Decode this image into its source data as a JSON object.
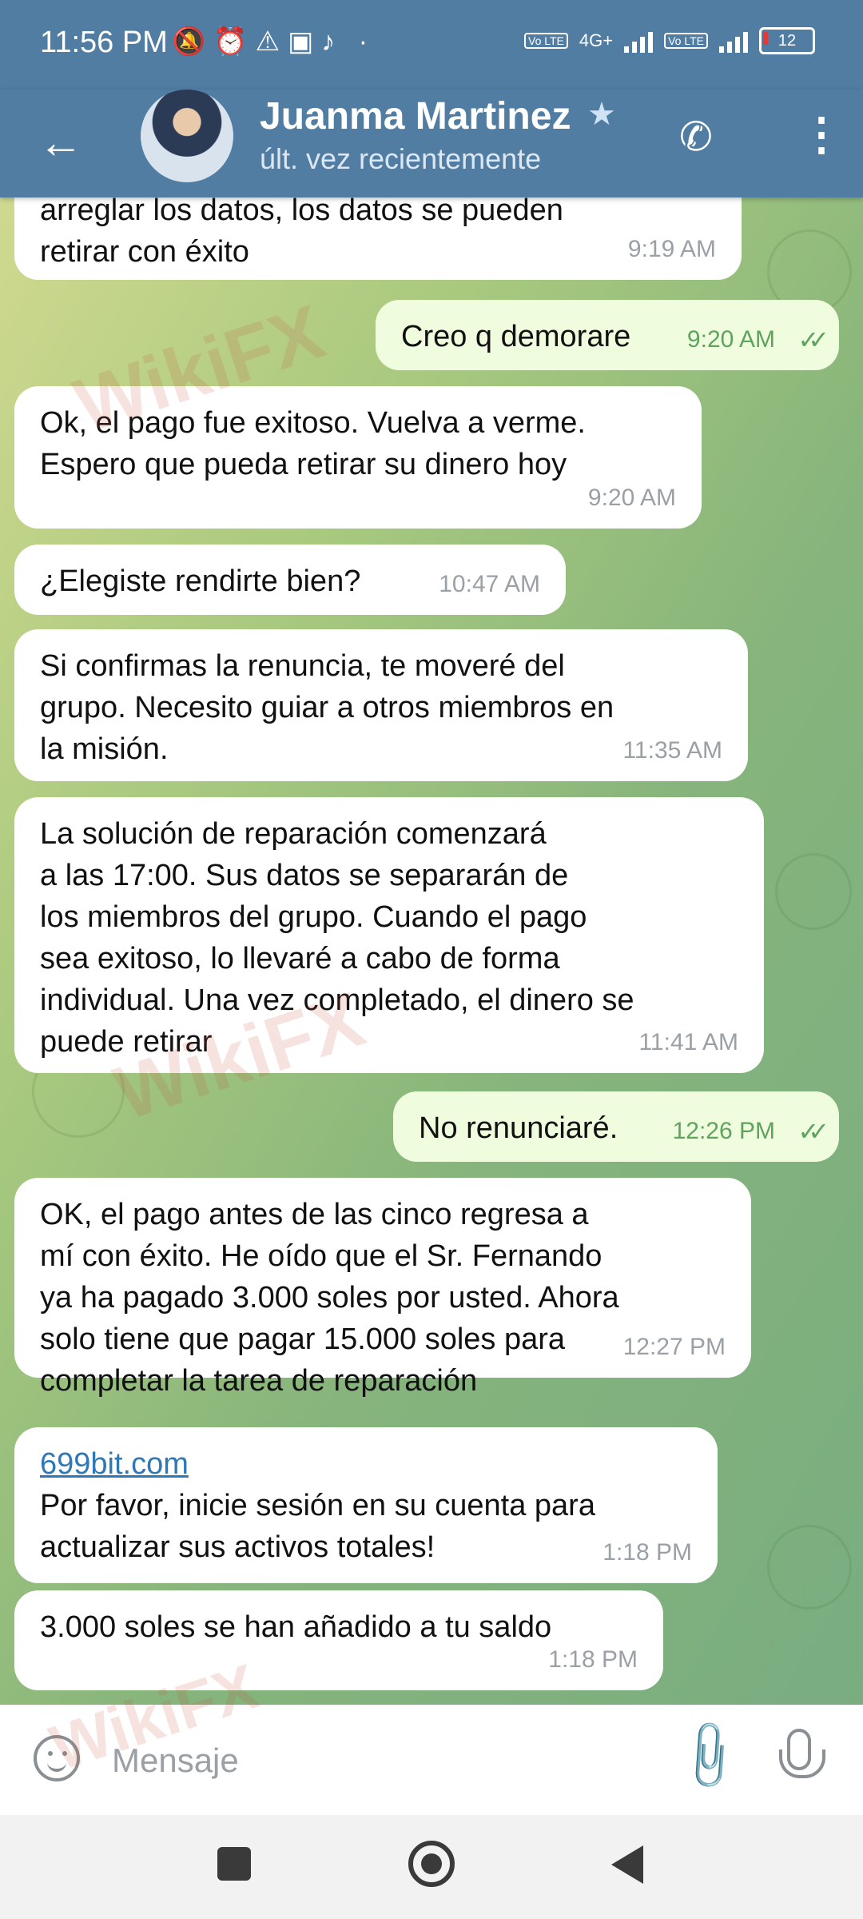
{
  "status_bar": {
    "time": "11:56 PM",
    "left_icons": "🔕⏰⚠▣♪ ·",
    "network1": "Vo LTE",
    "network_type": "4G+",
    "network2": "Vo LTE",
    "battery": "12"
  },
  "header": {
    "back_icon": "←",
    "contact_name": "Juanma Martinez",
    "star_icon": "★",
    "status": "últ. vez recientemente",
    "call_icon": "✆",
    "menu_icon": "⋮"
  },
  "messages": [
    {
      "dir": "in",
      "text": "arreglar los datos, los datos se pueden\nretirar con éxito",
      "time": "9:19 AM"
    },
    {
      "dir": "out",
      "text": "Creo q demorare",
      "time": "9:20 AM",
      "ticks": "✓✓"
    },
    {
      "dir": "in",
      "text": "Ok, el pago fue exitoso. Vuelva a verme.\nEspero que pueda retirar su dinero hoy",
      "time": "9:20 AM"
    },
    {
      "dir": "in",
      "text": "¿Elegiste rendirte bien?",
      "time": "10:47 AM"
    },
    {
      "dir": "in",
      "text": "Si confirmas la renuncia, te moveré del\ngrupo. Necesito guiar a otros miembros en\nla misión.",
      "time": "11:35 AM"
    },
    {
      "dir": "in",
      "text": "La solución de reparación comenzará\na las 17:00. Sus datos se separarán de\nlos miembros del grupo. Cuando el pago\nsea exitoso, lo llevaré a cabo de forma\nindividual. Una vez completado, el dinero se\npuede retirar",
      "time": "11:41 AM"
    },
    {
      "dir": "out",
      "text": "No renunciaré.",
      "time": "12:26 PM",
      "ticks": "✓✓"
    },
    {
      "dir": "in",
      "text": "OK, el pago antes de las cinco regresa a\nmí con éxito. He oído que el Sr. Fernando\nya ha pagado 3.000 soles por usted. Ahora\nsolo tiene que pagar 15.000 soles para\ncompletar la tarea de reparación",
      "time": "12:27 PM"
    },
    {
      "dir": "in",
      "link": "699bit.com",
      "text": "Por favor, inicie sesión en su cuenta para\nactualizar sus activos totales!",
      "time": "1:18 PM"
    },
    {
      "dir": "in",
      "text": "3.000 soles se han añadido a tu saldo",
      "time": "1:18 PM"
    }
  ],
  "composer": {
    "placeholder": "Mensaje",
    "emoji_icon": "emoji-icon",
    "attach_icon": "📎",
    "mic_icon": "mic-icon"
  },
  "watermark": "WikiFX"
}
